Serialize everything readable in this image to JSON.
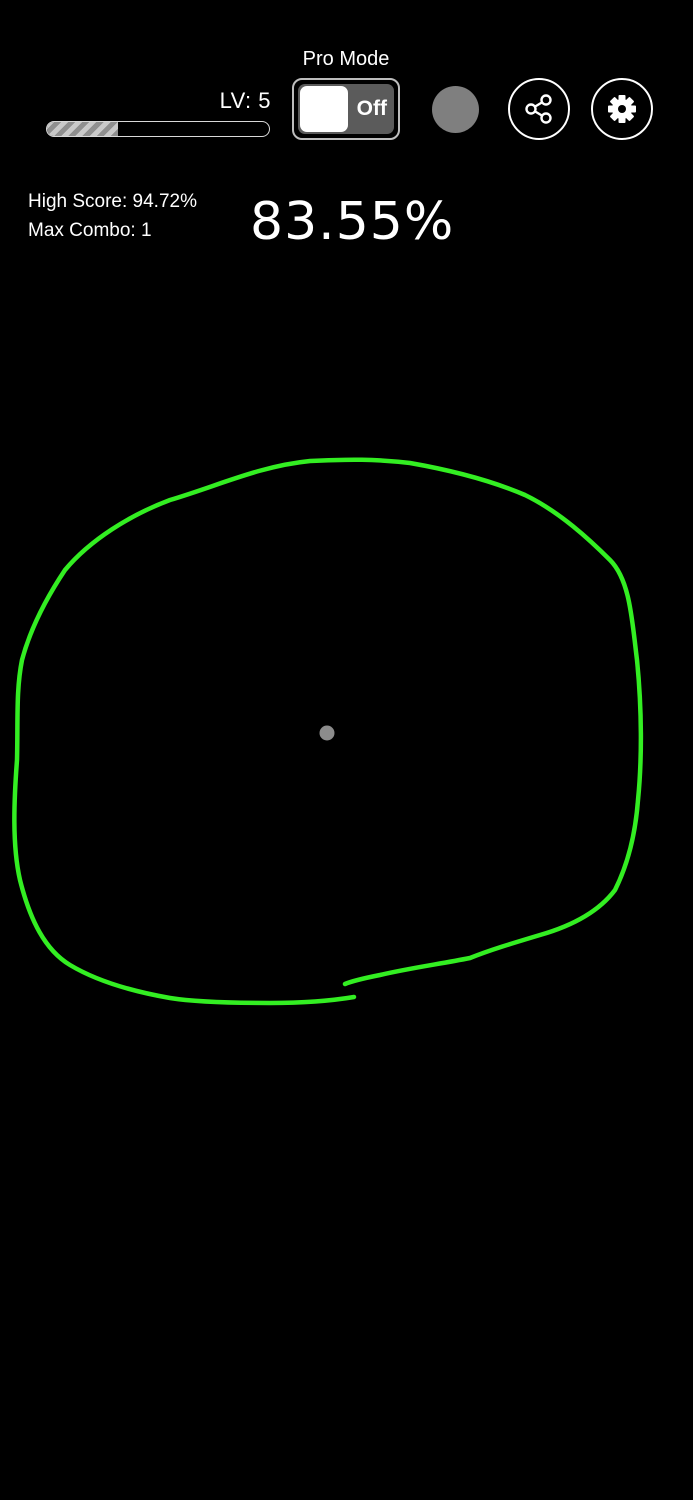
{
  "header": {
    "level_label": "LV: 5",
    "level_progress": 0.32,
    "pro_mode": {
      "label": "Pro Mode",
      "state_text": "Off"
    },
    "record_indicator_color": "#7f7f7f",
    "share_icon": "share-icon",
    "settings_icon": "gear-icon"
  },
  "stats": {
    "high_score": "High Score: 94.72%",
    "max_combo": "Max Combo: 1"
  },
  "score": "83.55%",
  "stroke": {
    "color": "#33ee22"
  },
  "center_dot_color": "#8c8c8c"
}
